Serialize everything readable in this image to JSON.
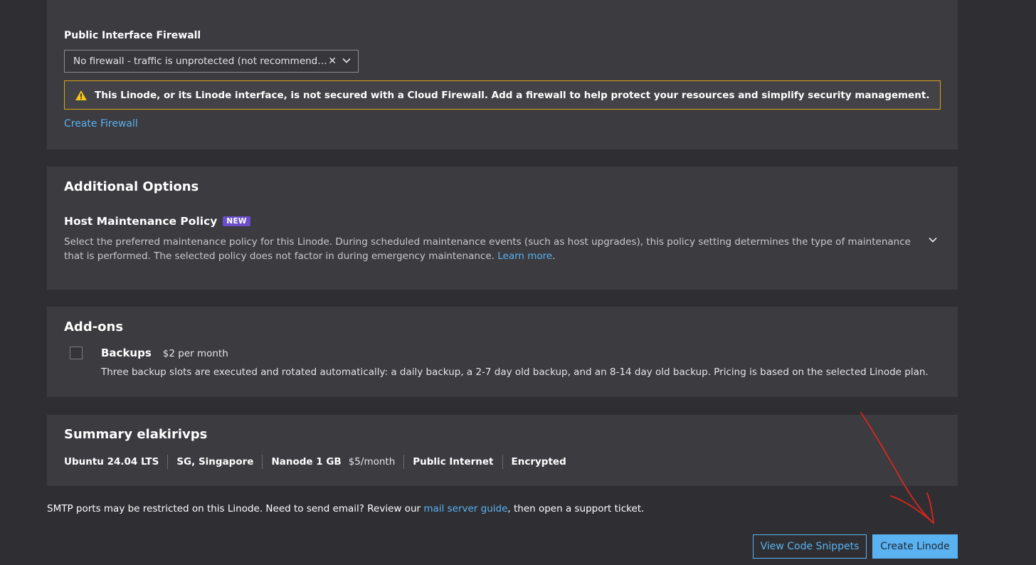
{
  "firewall": {
    "label": "Public Interface Firewall",
    "select_value": "No firewall - traffic is unprotected (not recommended)",
    "clear_glyph": "✕",
    "warning_text": "This Linode, or its Linode interface, is not secured with a Cloud Firewall. Add a firewall to help protect your resources and simplify security management.",
    "create_link": "Create Firewall"
  },
  "additional_options": {
    "title": "Additional Options",
    "policy_title": "Host Maintenance Policy",
    "badge": "NEW",
    "description": "Select the preferred maintenance policy for this Linode. During scheduled maintenance events (such as host upgrades), this policy setting determines the type of maintenance that is performed. The selected policy does not factor in during emergency maintenance.",
    "learn_more": "Learn more",
    "period": "."
  },
  "addons": {
    "title": "Add-ons",
    "backups": {
      "name": "Backups",
      "price": "$2 per month",
      "checked": false,
      "description": "Three backup slots are executed and rotated automatically: a daily backup, a 2-7 day old backup, and an 8-14 day old backup. Pricing is based on the selected Linode plan."
    }
  },
  "summary": {
    "title": "Summary elakirivps",
    "items": {
      "image": "Ubuntu 24.04 LTS",
      "region": "SG, Singapore",
      "plan": "Nanode 1 GB",
      "plan_price": "$5/month",
      "network": "Public Internet",
      "encryption": "Encrypted"
    }
  },
  "smtp": {
    "prefix": "SMTP ports may be restricted on this Linode. Need to send email? Review our ",
    "link": "mail server guide",
    "suffix": ", then open a support ticket."
  },
  "actions": {
    "view_snippets": "View Code Snippets",
    "create": "Create Linode"
  },
  "colors": {
    "accent": "#5ab2f0",
    "warning_border": "#d8a418",
    "badge": "#6a4fc9",
    "annotation": "#d9261c"
  }
}
